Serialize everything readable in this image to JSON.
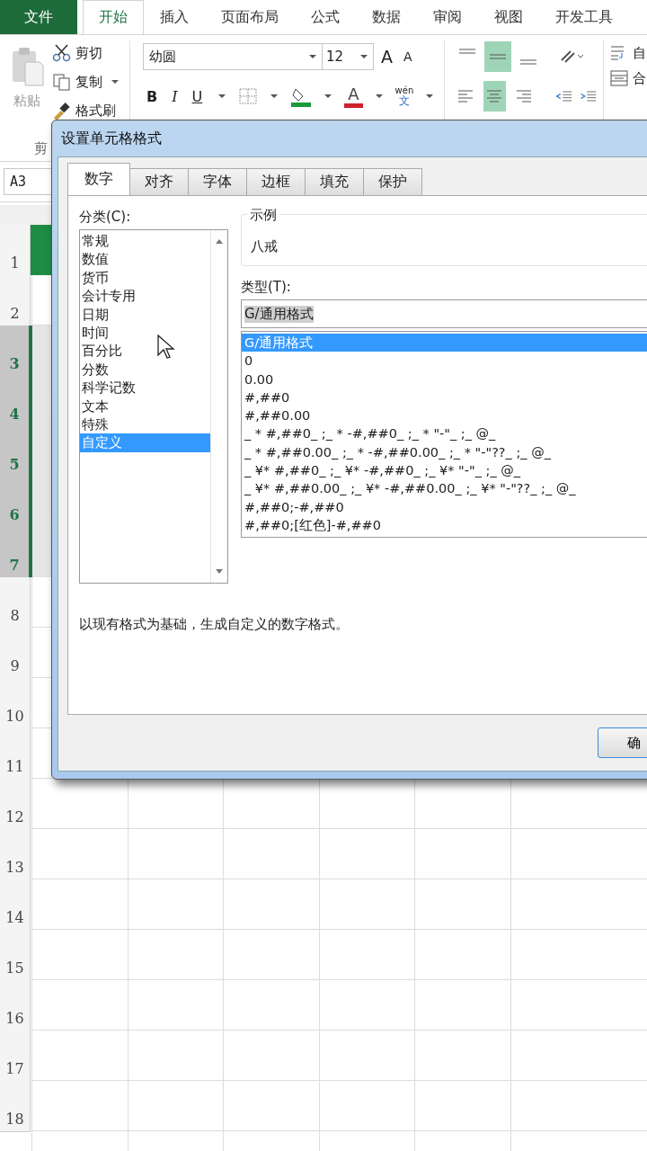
{
  "ribbon_tabs": [
    {
      "label": "文件",
      "kind": "file",
      "selected": false
    },
    {
      "label": "开始",
      "kind": "tab",
      "selected": true
    },
    {
      "label": "插入",
      "kind": "tab",
      "selected": false
    },
    {
      "label": "页面布局",
      "kind": "tab",
      "selected": false
    },
    {
      "label": "公式",
      "kind": "tab",
      "selected": false
    },
    {
      "label": "数据",
      "kind": "tab",
      "selected": false
    },
    {
      "label": "审阅",
      "kind": "tab",
      "selected": false
    },
    {
      "label": "视图",
      "kind": "tab",
      "selected": false
    },
    {
      "label": "开发工具",
      "kind": "tab",
      "selected": false
    }
  ],
  "clipboard": {
    "paste": "粘贴",
    "cut": "剪切",
    "copy": "复制",
    "format_painter": "格式刷",
    "group_label": "剪"
  },
  "font": {
    "name": "幼圆",
    "size": "12",
    "bold": "B",
    "italic": "I",
    "underline": "U",
    "grow": "A",
    "shrink": "A",
    "font_color": "A",
    "phonetic": "wén",
    "phonetic_base": "文"
  },
  "vertical_align": [
    {
      "kind": "top",
      "selected": false
    },
    {
      "kind": "middle",
      "selected": true
    },
    {
      "kind": "bottom",
      "selected": false
    }
  ],
  "horizontal_align": [
    {
      "kind": "left",
      "selected": false
    },
    {
      "kind": "center",
      "selected": true
    },
    {
      "kind": "right",
      "selected": false
    }
  ],
  "wrap_label": "自",
  "merge_label": "合",
  "name_box": "A3",
  "rows": [
    {
      "label": "1",
      "selected": false
    },
    {
      "label": "2",
      "selected": false
    },
    {
      "label": "3",
      "selected": true
    },
    {
      "label": "4",
      "selected": true
    },
    {
      "label": "5",
      "selected": true
    },
    {
      "label": "6",
      "selected": true
    },
    {
      "label": "7",
      "selected": true
    },
    {
      "label": "8",
      "selected": false
    },
    {
      "label": "9",
      "selected": false
    },
    {
      "label": "10",
      "selected": false
    },
    {
      "label": "11",
      "selected": false
    },
    {
      "label": "12",
      "selected": false
    },
    {
      "label": "13",
      "selected": false
    },
    {
      "label": "14",
      "selected": false
    },
    {
      "label": "15",
      "selected": false
    },
    {
      "label": "16",
      "selected": false
    },
    {
      "label": "17",
      "selected": false
    },
    {
      "label": "18",
      "selected": false
    }
  ],
  "dialog": {
    "title": "设置单元格格式",
    "tabs": [
      {
        "label": "数字",
        "selected": true
      },
      {
        "label": "对齐",
        "selected": false
      },
      {
        "label": "字体",
        "selected": false
      },
      {
        "label": "边框",
        "selected": false
      },
      {
        "label": "填充",
        "selected": false
      },
      {
        "label": "保护",
        "selected": false
      }
    ],
    "category_label": "分类(C):",
    "categories": [
      {
        "label": "常规",
        "selected": false
      },
      {
        "label": "数值",
        "selected": false
      },
      {
        "label": "货币",
        "selected": false
      },
      {
        "label": "会计专用",
        "selected": false
      },
      {
        "label": "日期",
        "selected": false
      },
      {
        "label": "时间",
        "selected": false
      },
      {
        "label": "百分比",
        "selected": false
      },
      {
        "label": "分数",
        "selected": false
      },
      {
        "label": "科学记数",
        "selected": false
      },
      {
        "label": "文本",
        "selected": false
      },
      {
        "label": "特殊",
        "selected": false
      },
      {
        "label": "自定义",
        "selected": true
      }
    ],
    "sample_label": "示例",
    "sample_value": "八戒",
    "type_label": "类型(T):",
    "type_value": "G/通用格式",
    "types": [
      {
        "label": "G/通用格式",
        "selected": true
      },
      {
        "label": "0",
        "selected": false
      },
      {
        "label": "0.00",
        "selected": false
      },
      {
        "label": "#,##0",
        "selected": false
      },
      {
        "label": "#,##0.00",
        "selected": false
      },
      {
        "label": "_ * #,##0_ ;_ * -#,##0_ ;_ * \"-\"_ ;_ @_",
        "selected": false
      },
      {
        "label": "_ * #,##0.00_ ;_ * -#,##0.00_ ;_ * \"-\"??_ ;_ @_",
        "selected": false
      },
      {
        "label": "_ ¥* #,##0_ ;_ ¥* -#,##0_ ;_ ¥* \"-\"_ ;_ @_",
        "selected": false
      },
      {
        "label": "_ ¥* #,##0.00_ ;_ ¥* -#,##0.00_ ;_ ¥* \"-\"??_ ;_ @_",
        "selected": false
      },
      {
        "label": "#,##0;-#,##0",
        "selected": false
      },
      {
        "label": "#,##0;[红色]-#,##0",
        "selected": false
      }
    ],
    "description": "以现有格式为基础，生成自定义的数字格式。",
    "ok": "确"
  }
}
